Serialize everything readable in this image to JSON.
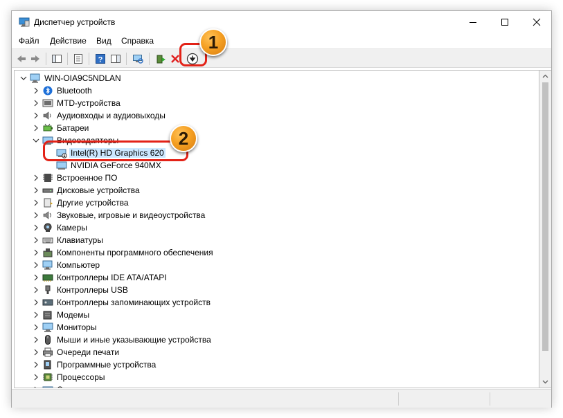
{
  "window": {
    "title": "Диспетчер устройств"
  },
  "menu": [
    "Файл",
    "Действие",
    "Вид",
    "Справка"
  ],
  "toolbar": {
    "buttons": [
      "back-icon",
      "forward-icon",
      "properties-icon",
      "help-icon",
      "scan-hardware-icon",
      "enable-device-icon",
      "uninstall-device-icon",
      "update-driver-icon"
    ]
  },
  "tree": {
    "root": "WIN-OIA9C5NDLAN",
    "categories": [
      {
        "label": "Bluetooth",
        "icon": "bluetooth-icon"
      },
      {
        "label": "MTD-устройства",
        "icon": "mtd-icon"
      },
      {
        "label": "Аудиовходы и аудиовыходы",
        "icon": "speaker-icon"
      },
      {
        "label": "Батареи",
        "icon": "battery-icon"
      },
      {
        "label": "Видеоадаптеры",
        "icon": "display-adapter-icon",
        "expanded": true,
        "children": [
          {
            "label": "Intel(R) HD Graphics 620",
            "selected": true
          },
          {
            "label": "NVIDIA GeForce 940MX"
          }
        ]
      },
      {
        "label": "Встроенное ПО",
        "icon": "firmware-icon"
      },
      {
        "label": "Дисковые устройства",
        "icon": "disk-icon"
      },
      {
        "label": "Другие устройства",
        "icon": "unknown-device-icon"
      },
      {
        "label": "Звуковые, игровые и видеоустройства",
        "icon": "sound-icon"
      },
      {
        "label": "Камеры",
        "icon": "camera-icon"
      },
      {
        "label": "Клавиатуры",
        "icon": "keyboard-icon"
      },
      {
        "label": "Компоненты программного обеспечения",
        "icon": "software-component-icon"
      },
      {
        "label": "Компьютер",
        "icon": "computer-icon"
      },
      {
        "label": "Контроллеры IDE ATA/ATAPI",
        "icon": "ide-controller-icon"
      },
      {
        "label": "Контроллеры USB",
        "icon": "usb-icon"
      },
      {
        "label": "Контроллеры запоминающих устройств",
        "icon": "storage-controller-icon"
      },
      {
        "label": "Модемы",
        "icon": "modem-icon"
      },
      {
        "label": "Мониторы",
        "icon": "monitor-icon"
      },
      {
        "label": "Мыши и иные указывающие устройства",
        "icon": "mouse-icon"
      },
      {
        "label": "Очереди печати",
        "icon": "printer-icon"
      },
      {
        "label": "Программные устройства",
        "icon": "software-device-icon"
      },
      {
        "label": "Процессоры",
        "icon": "processor-icon"
      },
      {
        "label": "Сетевые адаптеры",
        "icon": "network-adapter-icon"
      }
    ]
  },
  "callouts": [
    "1",
    "2"
  ],
  "colors": {
    "callout_border": "#e32217",
    "badge": "#f5a023",
    "selection": "#cce8ff"
  }
}
